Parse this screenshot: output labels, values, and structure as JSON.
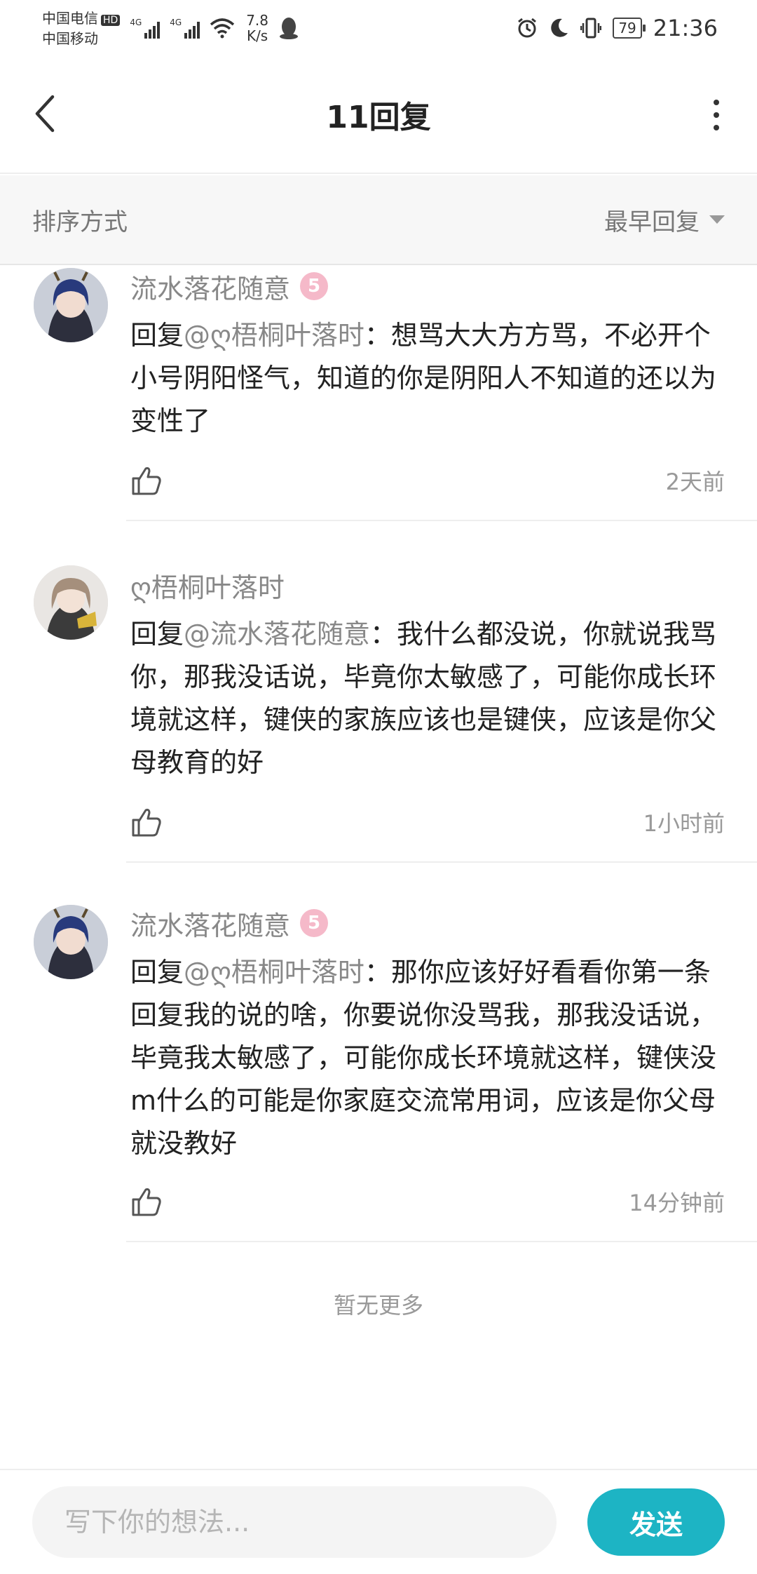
{
  "status_bar": {
    "carrier_1": "中国电信",
    "hd_badge": "HD",
    "carrier_2": "中国移动",
    "network_1": "4G",
    "network_2": "4G",
    "speed_value": "7.8",
    "speed_unit": "K/s",
    "battery": "79",
    "time": "21:36"
  },
  "header": {
    "title": "11回复"
  },
  "sort": {
    "label": "排序方式",
    "selected": "最早回复"
  },
  "comments": [
    {
      "author": "流水落花随意",
      "level": "5",
      "prefix": "回复",
      "mention": "@ღ梧桐叶落时",
      "content": "：想骂大大方方骂，不必开个小号阴阳怪气，知道的你是阴阳人不知道的还以为变性了",
      "time": "2天前"
    },
    {
      "author": "ღ梧桐叶落时",
      "prefix": "回复",
      "mention": "@流水落花随意",
      "content": "：我什么都没说，你就说我骂你，那我没话说，毕竟你太敏感了，可能你成长环境就这样，键侠的家族应该也是键侠，应该是你父母教育的好",
      "time": "1小时前"
    },
    {
      "author": "流水落花随意",
      "level": "5",
      "prefix": "回复",
      "mention": "@ღ梧桐叶落时",
      "content": "：那你应该好好看看你第一条回复我的说的啥，你要说你没骂我，那我没话说，毕竟我太敏感了，可能你成长环境就这样，键侠没m什么的可能是你家庭交流常用词，应该是你父母就没教好",
      "time": "14分钟前"
    }
  ],
  "footer_note": "暂无更多",
  "reply_box": {
    "placeholder": "写下你的想法...",
    "send_label": "发送"
  },
  "colors": {
    "accent": "#1db4c4",
    "level_badge": "#f5b9c9"
  }
}
